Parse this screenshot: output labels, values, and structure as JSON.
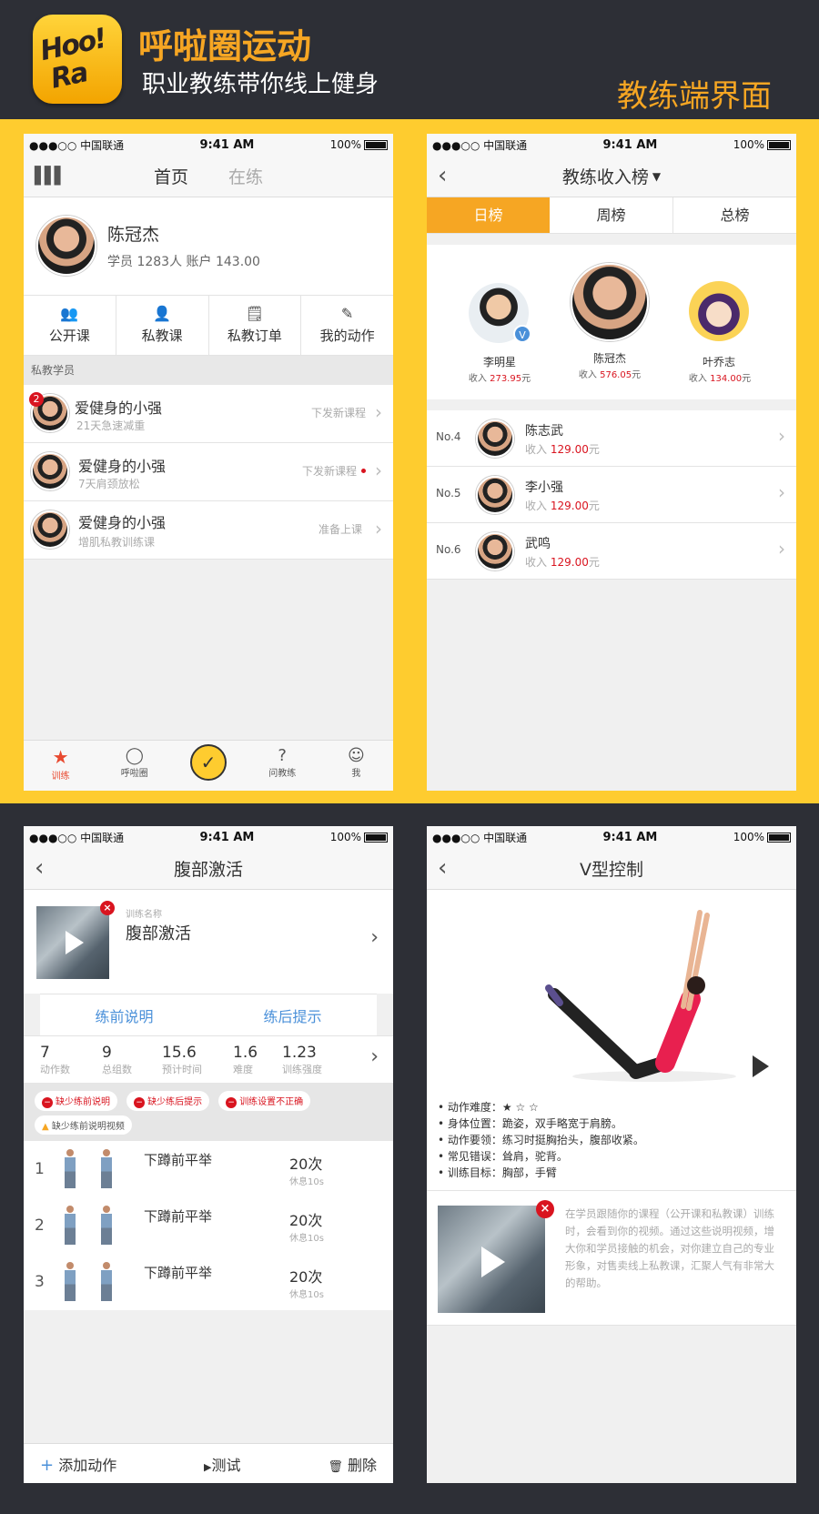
{
  "header": {
    "logo_line1": "Hoo!",
    "logo_line2": "Ra",
    "app_name": "呼啦圈运动",
    "slogan": "职业教练带你线上健身",
    "coach_label": "教练端界面"
  },
  "status": {
    "carrier": "●●●○○ 中国联通",
    "time": "9:41 AM",
    "battery": "100%"
  },
  "s1": {
    "tabs": [
      "首页",
      "在练"
    ],
    "profile": {
      "name": "陈冠杰",
      "stats": "学员 1283人   账户 143.00"
    },
    "actions": [
      {
        "icon": "people-icon",
        "label": "公开课"
      },
      {
        "icon": "person-icon",
        "label": "私教课"
      },
      {
        "icon": "order-icon",
        "label": "私教订单"
      },
      {
        "icon": "action-icon",
        "label": "我的动作"
      }
    ],
    "section": "私教学员",
    "students": [
      {
        "badge": "2",
        "name": "爱健身的小强",
        "sub": "21天急速减重",
        "status": "下发新课程"
      },
      {
        "name": "爱健身的小强",
        "sub": "7天肩颈放松",
        "status": "下发新课程"
      },
      {
        "name": "爱健身的小强",
        "sub": "增肌私教训练课",
        "status": "准备上课"
      }
    ],
    "tabbar": [
      {
        "icon": "star-icon",
        "label": "训练"
      },
      {
        "icon": "bubble-icon",
        "label": "呼啦圈"
      },
      {
        "icon": "check-icon",
        "label": ""
      },
      {
        "icon": "question-icon",
        "label": "问教练"
      },
      {
        "icon": "user-icon",
        "label": "我"
      }
    ]
  },
  "s2": {
    "title": "教练收入榜",
    "seg": [
      "日榜",
      "周榜",
      "总榜"
    ],
    "podium": [
      {
        "name": "李明星",
        "income_label": "收入",
        "amount": "273.95",
        "unit": "元"
      },
      {
        "name": "陈冠杰",
        "income_label": "收入",
        "amount": "576.05",
        "unit": "元"
      },
      {
        "name": "叶乔志",
        "income_label": "收入",
        "amount": "134.00",
        "unit": "元"
      }
    ],
    "list": [
      {
        "rank": "No.4",
        "name": "陈志武",
        "income_label": "收入",
        "amount": "129.00",
        "unit": "元"
      },
      {
        "rank": "No.5",
        "name": "李小强",
        "income_label": "收入",
        "amount": "129.00",
        "unit": "元"
      },
      {
        "rank": "No.6",
        "name": "武鸣",
        "income_label": "收入",
        "amount": "129.00",
        "unit": "元"
      }
    ]
  },
  "s3": {
    "title": "腹部激活",
    "name_label": "训练名称",
    "name": "腹部激活",
    "tabs": [
      "练前说明",
      "练后提示"
    ],
    "stats": [
      {
        "value": "7",
        "label": "动作数"
      },
      {
        "value": "9",
        "label": "总组数"
      },
      {
        "value": "15.6",
        "label": "预计时间"
      },
      {
        "value": "1.6",
        "label": "难度"
      },
      {
        "value": "1.23",
        "label": "训练强度"
      }
    ],
    "tags": [
      "缺少练前说明",
      "缺少练后提示",
      "训练设置不正确"
    ],
    "warn": "缺少练前说明视频",
    "exercises": [
      {
        "n": "1",
        "name": "下蹲前平举",
        "reps": "20次",
        "rest": "休息10s"
      },
      {
        "n": "2",
        "name": "下蹲前平举",
        "reps": "20次",
        "rest": "休息10s"
      },
      {
        "n": "3",
        "name": "下蹲前平举",
        "reps": "20次",
        "rest": "休息10s"
      }
    ],
    "bottom": {
      "add": "添加动作",
      "test": "测试",
      "del": "删除"
    }
  },
  "s4": {
    "title": "V型控制",
    "difficulty_label": "• 动作难度：",
    "difficulty_stars": "★ ☆ ☆",
    "details": [
      "• 身体位置：跪姿，双手略宽于肩膀。",
      "• 动作要领：练习时挺胸抬头，腹部收紧。",
      "• 常见错误：耸肩，驼背。",
      "• 训练目标：胸部，手臂"
    ],
    "video_text": "在学员跟随你的课程（公开课和私教课）训练时，会看到你的视频。通过这些说明视频，增大你和学员接触的机会，对你建立自己的专业形象，对售卖线上私教课，汇聚人气有非常大的帮助。"
  },
  "colors": {
    "accent": "#f6a623",
    "yellow": "#fecc2f",
    "dark": "#2d2f36",
    "red": "#d9141f",
    "blue": "#4a90d9"
  }
}
